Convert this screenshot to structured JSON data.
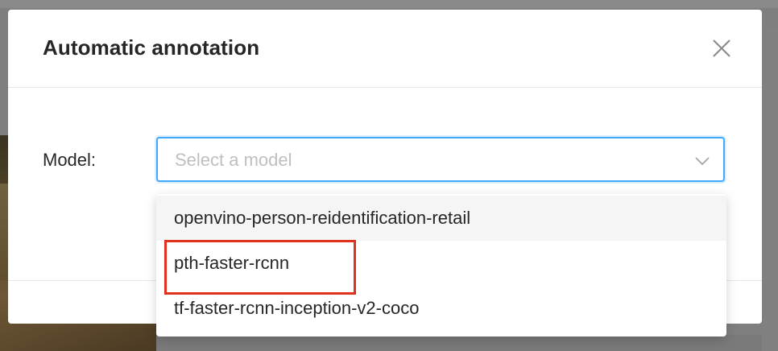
{
  "dialog": {
    "title": "Automatic annotation",
    "close_label": "X"
  },
  "form": {
    "model_label": "Model:",
    "model_placeholder": "Select a model"
  },
  "dropdown": {
    "options": [
      {
        "label": "openvino-person-reidentification-retail",
        "hovered": true
      },
      {
        "label": "pth-faster-rcnn",
        "highlighted_by_annotation": true
      },
      {
        "label": "tf-faster-rcnn-inception-v2-coco"
      }
    ]
  },
  "colors": {
    "focus_border": "#40a9ff",
    "annotation_box": "#e0311f",
    "hover_background": "#f5f5f5"
  },
  "icons": {
    "close": "close-icon",
    "select_arrow": "chevron-down-icon"
  }
}
